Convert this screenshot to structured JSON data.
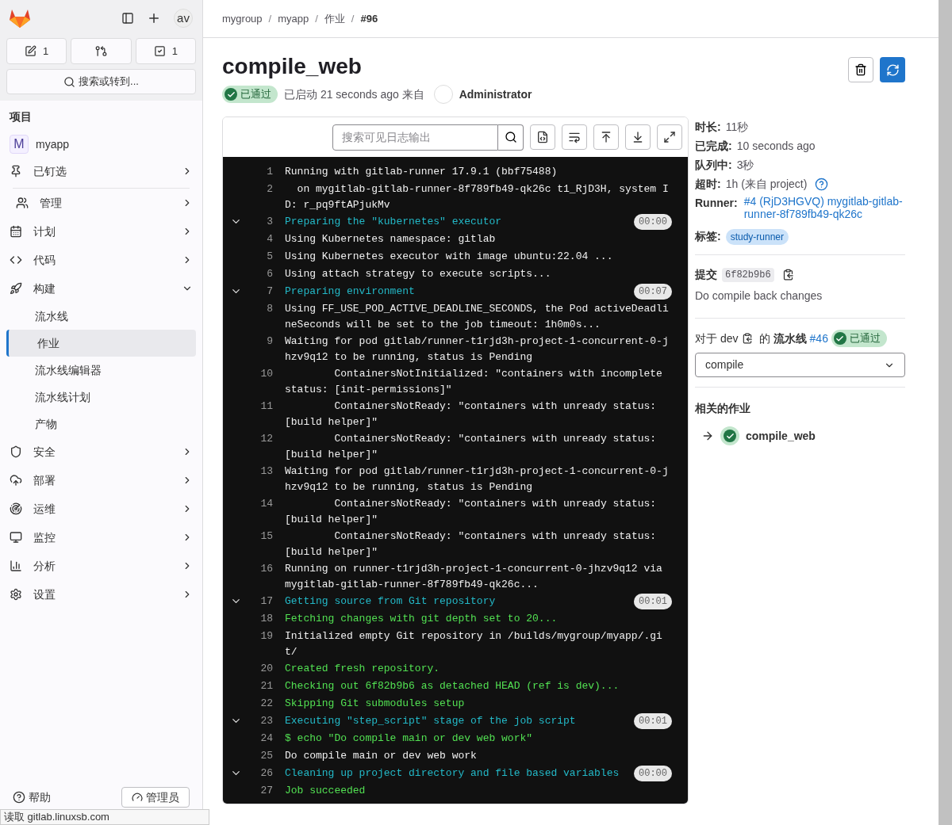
{
  "sidebar": {
    "counters": [
      {
        "kind": "issues",
        "count": "1"
      },
      {
        "kind": "merge_requests"
      },
      {
        "kind": "todos",
        "count": "1"
      }
    ],
    "avatar": "av",
    "search": "搜索或转到...",
    "section_title": "项目",
    "project": {
      "initial": "M",
      "name": "myapp"
    },
    "items": [
      {
        "label": "已钉选",
        "expanded": false
      },
      {
        "label": "管理",
        "expanded": false
      },
      {
        "label": "计划",
        "expanded": false
      },
      {
        "label": "代码",
        "expanded": false
      },
      {
        "label": "构建",
        "expanded": true,
        "children": [
          {
            "label": "流水线",
            "selected": false
          },
          {
            "label": "作业",
            "selected": true
          },
          {
            "label": "流水线编辑器",
            "selected": false
          },
          {
            "label": "流水线计划",
            "selected": false
          },
          {
            "label": "产物",
            "selected": false
          }
        ]
      },
      {
        "label": "安全",
        "expanded": false
      },
      {
        "label": "部署",
        "expanded": false
      },
      {
        "label": "运维",
        "expanded": false
      },
      {
        "label": "监控",
        "expanded": false
      },
      {
        "label": "分析",
        "expanded": false
      },
      {
        "label": "设置",
        "expanded": false
      }
    ],
    "footer": {
      "help": "帮助",
      "admin": "管理员"
    }
  },
  "breadcrumb": [
    {
      "label": "mygroup"
    },
    {
      "separator": "/",
      "label": "myapp"
    },
    {
      "separator": "/",
      "label": "作业"
    },
    {
      "separator": "/",
      "label": "#96"
    }
  ],
  "job": {
    "title": "compile_web",
    "status": "已通过",
    "started": "已启动 21 seconds ago 来自",
    "user": "Administrator"
  },
  "log": {
    "search_placeholder": "搜索可见日志输出",
    "lines": [
      {
        "n": "1",
        "kind": "plain",
        "text": "Running with gitlab-runner 17.9.1 (bbf75488)"
      },
      {
        "n": "2",
        "kind": "plain",
        "text": "  on mygitlab-gitlab-runner-8f789fb49-qk26c t1_RjD3H, system ID: r_pq9ftAPjukMv"
      },
      {
        "n": "3",
        "kind": "section",
        "text": "Preparing the \"kubernetes\" executor",
        "duration": "00:00"
      },
      {
        "n": "4",
        "kind": "plain",
        "text": "Using Kubernetes namespace: gitlab"
      },
      {
        "n": "5",
        "kind": "plain",
        "text": "Using Kubernetes executor with image ubuntu:22.04 ..."
      },
      {
        "n": "6",
        "kind": "plain",
        "text": "Using attach strategy to execute scripts..."
      },
      {
        "n": "7",
        "kind": "section",
        "text": "Preparing environment",
        "duration": "00:07"
      },
      {
        "n": "8",
        "kind": "plain",
        "text": "Using FF_USE_POD_ACTIVE_DEADLINE_SECONDS, the Pod activeDeadlineSeconds will be set to the job timeout: 1h0m0s..."
      },
      {
        "n": "9",
        "kind": "plain",
        "text": "Waiting for pod gitlab/runner-t1rjd3h-project-1-concurrent-0-jhzv9q12 to be running, status is Pending"
      },
      {
        "n": "10",
        "kind": "plain",
        "text": "        ContainersNotInitialized: \"containers with incomplete status: [init-permissions]\""
      },
      {
        "n": "11",
        "kind": "plain",
        "text": "        ContainersNotReady: \"containers with unready status: [build helper]\""
      },
      {
        "n": "12",
        "kind": "plain",
        "text": "        ContainersNotReady: \"containers with unready status: [build helper]\""
      },
      {
        "n": "13",
        "kind": "plain",
        "text": "Waiting for pod gitlab/runner-t1rjd3h-project-1-concurrent-0-jhzv9q12 to be running, status is Pending"
      },
      {
        "n": "14",
        "kind": "plain",
        "text": "        ContainersNotReady: \"containers with unready status: [build helper]\""
      },
      {
        "n": "15",
        "kind": "plain",
        "text": "        ContainersNotReady: \"containers with unready status: [build helper]\""
      },
      {
        "n": "16",
        "kind": "plain",
        "text": "Running on runner-t1rjd3h-project-1-concurrent-0-jhzv9q12 via mygitlab-gitlab-runner-8f789fb49-qk26c..."
      },
      {
        "n": "17",
        "kind": "section",
        "text": "Getting source from Git repository",
        "duration": "00:01"
      },
      {
        "n": "18",
        "kind": "success",
        "text": "Fetching changes with git depth set to 20..."
      },
      {
        "n": "19",
        "kind": "plain",
        "text": "Initialized empty Git repository in /builds/mygroup/myapp/.git/"
      },
      {
        "n": "20",
        "kind": "success",
        "text": "Created fresh repository."
      },
      {
        "n": "21",
        "kind": "success",
        "text": "Checking out 6f82b9b6 as detached HEAD (ref is dev)..."
      },
      {
        "n": "22",
        "kind": "success",
        "text": "Skipping Git submodules setup"
      },
      {
        "n": "23",
        "kind": "section",
        "text": "Executing \"step_script\" stage of the job script",
        "duration": "00:01"
      },
      {
        "n": "24",
        "kind": "success",
        "text": "$ echo \"Do compile main or dev web work\""
      },
      {
        "n": "25",
        "kind": "plain",
        "text": "Do compile main or dev web work"
      },
      {
        "n": "26",
        "kind": "section",
        "text": "Cleaning up project directory and file based variables",
        "duration": "00:00"
      },
      {
        "n": "27",
        "kind": "success",
        "text": "Job succeeded"
      }
    ]
  },
  "details": {
    "fields": [
      {
        "label": "时长:",
        "value": "11秒"
      },
      {
        "label": "已完成:",
        "value": "10 seconds ago"
      },
      {
        "label": "队列中:",
        "value": "3秒"
      },
      {
        "label": "超时:",
        "value": "1h (来自 project)"
      }
    ],
    "runner_label": "Runner:",
    "runner": "#4 (RjD3HGVQ) mygitlab-gitlab-runner-8f789fb49-qk26c",
    "tags_label": "标签:",
    "tag": "study-runner",
    "commit_label": "提交",
    "commit_sha": "6f82b9b6",
    "commit_message": "Do compile back changes",
    "pipeline": {
      "prefix": "对于",
      "ref": "dev",
      "middle": "的",
      "label": "流水线",
      "number": "#46",
      "status": "已通过"
    },
    "stage": "compile",
    "related_title": "相关的作业",
    "related_jobs": [
      {
        "name": "compile_web"
      }
    ]
  },
  "status_bar": "读取 gitlab.linuxsb.com"
}
